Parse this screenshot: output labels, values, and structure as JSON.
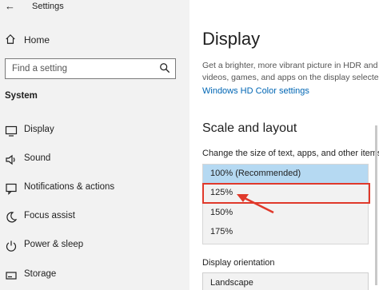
{
  "window": {
    "title": "Settings"
  },
  "sidebar": {
    "home_label": "Home",
    "search_placeholder": "Find a setting",
    "section_title": "System",
    "items": [
      {
        "label": "Display",
        "icon": "monitor-icon"
      },
      {
        "label": "Sound",
        "icon": "speaker-icon"
      },
      {
        "label": "Notifications & actions",
        "icon": "notification-icon"
      },
      {
        "label": "Focus assist",
        "icon": "moon-icon"
      },
      {
        "label": "Power & sleep",
        "icon": "power-icon"
      },
      {
        "label": "Storage",
        "icon": "storage-icon"
      }
    ]
  },
  "main": {
    "title": "Display",
    "hdr_desc_line1": "Get a brighter, more vibrant picture in HDR and",
    "hdr_desc_line2": "videos, games, and apps on the display selected",
    "hdr_link": "Windows HD Color settings",
    "scale_heading": "Scale and layout",
    "scale_caption": "Change the size of text, apps, and other items",
    "scale_options": [
      "100% (Recommended)",
      "125%",
      "150%",
      "175%"
    ],
    "scale_selected": "100% (Recommended)",
    "orientation_label": "Display orientation",
    "orientation_value": "Landscape"
  },
  "colors": {
    "sidebar_bg": "#f2f2f2",
    "accent_link": "#0066b4",
    "selected_option": "#b5d9f2",
    "annotation_red": "#e0392b"
  }
}
